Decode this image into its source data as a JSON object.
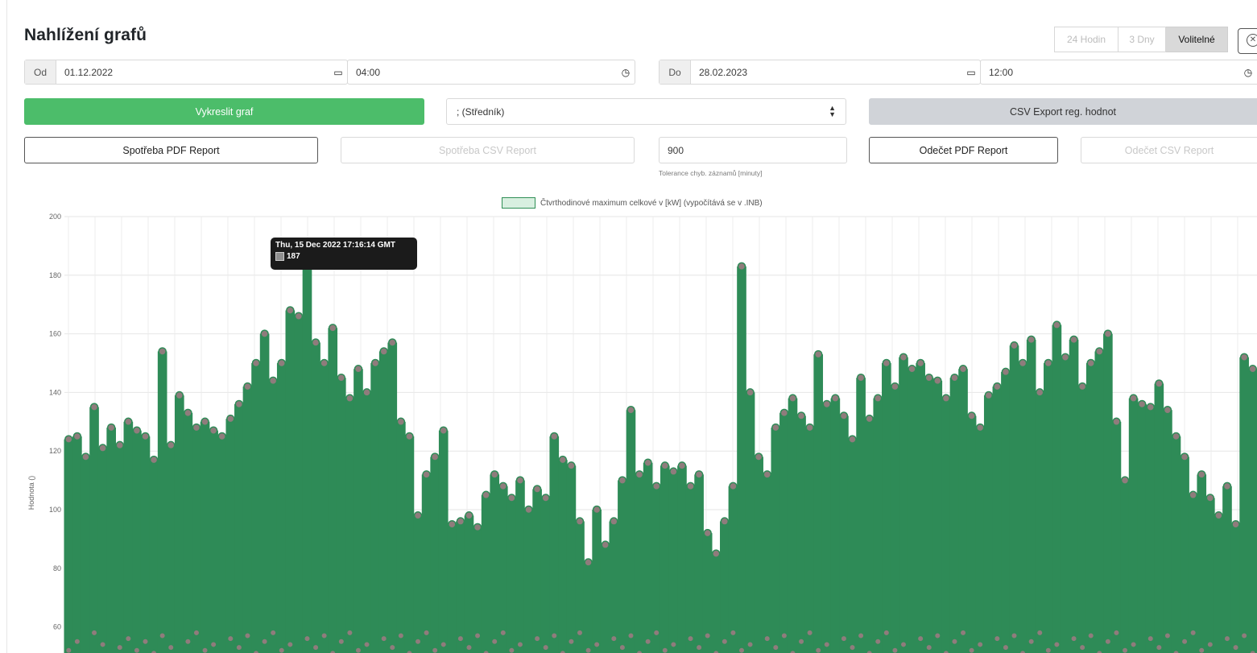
{
  "page": {
    "title": "Nahlížení grafů"
  },
  "range_buttons": {
    "h24": "24 Hodin",
    "d3": "3 Dny",
    "custom": "Volitelné",
    "close_icon": "close-circle-icon"
  },
  "from": {
    "prefix": "Od",
    "date": "01.12.2022",
    "time": "04:00",
    "calendar_icon": "calendar-icon",
    "clock_icon": "clock-icon"
  },
  "to": {
    "prefix": "Do",
    "date": "28.02.2023",
    "time": "12:00",
    "calendar_icon": "calendar-icon",
    "clock_icon": "clock-icon"
  },
  "actions": {
    "draw": "Vykreslit graf",
    "delimiter": "; (Středník)",
    "csv_export_reg": "CSV Export reg. hodnot",
    "consumption_pdf": "Spotřeba PDF Report",
    "consumption_csv": "Spotřeba CSV Report",
    "tolerance_value": "900",
    "tolerance_hint": "Tolerance chyb. záznamů [minuty]",
    "reading_pdf": "Odečet PDF Report",
    "reading_csv": "Odečet CSV Report"
  },
  "colors": {
    "green": "#4cbd6a",
    "series_line": "#2e8b57",
    "series_point": "#8f7c7c"
  },
  "tooltip": {
    "title": "Thu, 15 Dec 2022 17:16:14 GMT",
    "value": "187"
  },
  "chart_data": {
    "type": "line",
    "legend": "Čtvrthodinové maximum celkové v [kW] (vypočítává se v .INB)",
    "ylabel": "Hodnota ()",
    "ylim": [
      50,
      200
    ],
    "yticks": [
      "200",
      "180",
      "160",
      "140",
      "120",
      "100",
      "80",
      "60"
    ],
    "grid": true,
    "legend_position": "top",
    "series": [
      {
        "name": "Čtvrthodinové maximum celkové v [kW] (vypočítává se v .INB)",
        "peaks": [
          124,
          125,
          118,
          135,
          121,
          128,
          122,
          130,
          127,
          125,
          117,
          154,
          122,
          139,
          133,
          128,
          130,
          127,
          125,
          131,
          136,
          142,
          150,
          160,
          144,
          150,
          168,
          166,
          187,
          157,
          150,
          162,
          145,
          138,
          148,
          140,
          150,
          154,
          157,
          130,
          125,
          98,
          112,
          118,
          127,
          95,
          96,
          98,
          94,
          105,
          112,
          108,
          104,
          110,
          100,
          107,
          104,
          125,
          117,
          115,
          96,
          82,
          100,
          88,
          96,
          110,
          134,
          112,
          116,
          108,
          115,
          113,
          115,
          108,
          112,
          92,
          85,
          96,
          108,
          183,
          140,
          118,
          112,
          128,
          133,
          138,
          132,
          128,
          153,
          136,
          138,
          132,
          124,
          145,
          131,
          138,
          150,
          142,
          152,
          148,
          150,
          145,
          144,
          138,
          145,
          148,
          132,
          128,
          139,
          142,
          147,
          156,
          150,
          158,
          140,
          150,
          163,
          152,
          158,
          142,
          150,
          154,
          160,
          130,
          110,
          138,
          136,
          135,
          143,
          134,
          125,
          118,
          105,
          112,
          104,
          98,
          108,
          95,
          152,
          148
        ],
        "lows": [
          52,
          55,
          50,
          58,
          54,
          50,
          53,
          56,
          52,
          55,
          51,
          57,
          53,
          50,
          55,
          58,
          52,
          54,
          50,
          56,
          53,
          57,
          51,
          55,
          58,
          52,
          54,
          50,
          56,
          53,
          57,
          51,
          55,
          58,
          52,
          54,
          50,
          56,
          53,
          57,
          51,
          55,
          58,
          52,
          54,
          50,
          56,
          53,
          57,
          51,
          55,
          58,
          52,
          54,
          50,
          56,
          53,
          57,
          51,
          55,
          58,
          52,
          54,
          50,
          56,
          53,
          57,
          51,
          55,
          58,
          52,
          54,
          50,
          56,
          53,
          57,
          51,
          55,
          58,
          52,
          54,
          50,
          56,
          53,
          57,
          51,
          55,
          58,
          52,
          54,
          50,
          56,
          53,
          57,
          51,
          55,
          58,
          52,
          54,
          50,
          56,
          53,
          57,
          51,
          55,
          58,
          52,
          54,
          50,
          56,
          53,
          57,
          51,
          55,
          58,
          52,
          54,
          50,
          56,
          53,
          57,
          51,
          55,
          58,
          52,
          54,
          50,
          56,
          53,
          57,
          51,
          55,
          58,
          52,
          54,
          50,
          56,
          53,
          57,
          51
        ]
      }
    ]
  }
}
